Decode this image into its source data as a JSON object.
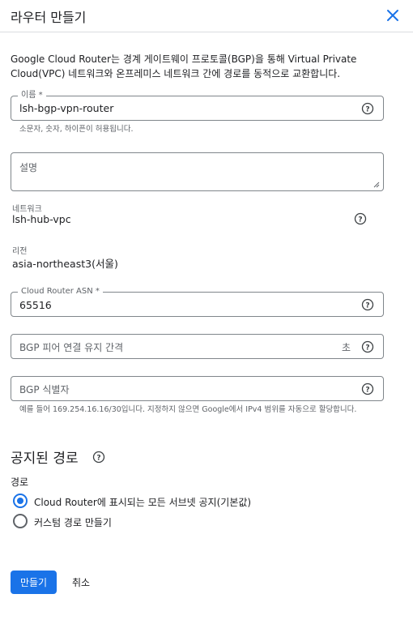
{
  "dialog": {
    "title": "라우터 만들기",
    "description": "Google Cloud Router는 경계 게이트웨이 프로토콜(BGP)을 통해 Virtual Private Cloud(VPC) 네트워크와 온프레미스 네트워크 간에 경로를 동적으로 교환합니다."
  },
  "name_field": {
    "label": "이름 *",
    "value": "lsh-bgp-vpn-router",
    "hint": "소문자, 숫자, 하이픈이 허용됩니다."
  },
  "description_field": {
    "placeholder": "설명"
  },
  "network": {
    "label": "네트워크",
    "value": "lsh-hub-vpc"
  },
  "region": {
    "label": "리전",
    "value": "asia-northeast3(서울)"
  },
  "asn_field": {
    "label": "Cloud Router ASN *",
    "value": "65516"
  },
  "keepalive_field": {
    "placeholder": "BGP 피어 연결 유지 간격",
    "suffix": "초"
  },
  "bgp_id_field": {
    "placeholder": "BGP 식별자",
    "hint": "예를 들어 169.254.16.16/30입니다. 지정하지 않으면 Google에서 IPv4 범위를 자동으로 할당합니다."
  },
  "advertised_routes": {
    "title": "공지된 경로",
    "routes_label": "경로",
    "options": [
      {
        "label": "Cloud Router에 표시되는 모든 서브넷 공지(기본값)",
        "selected": true
      },
      {
        "label": "커스텀 경로 만들기",
        "selected": false
      }
    ]
  },
  "actions": {
    "create": "만들기",
    "cancel": "취소"
  },
  "colors": {
    "accent": "#1a73e8",
    "border": "#80868b",
    "secondary_text": "#5f6368"
  }
}
